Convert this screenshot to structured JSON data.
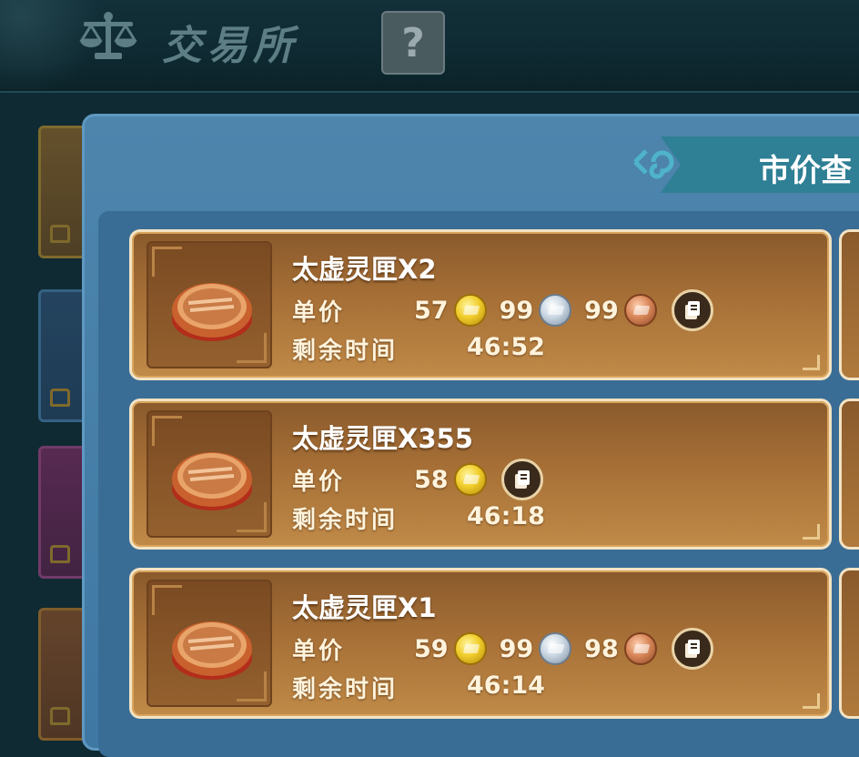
{
  "header": {
    "title": "交易所",
    "help_label": "?"
  },
  "panel": {
    "tab_label": "市价查"
  },
  "listings": [
    {
      "name": "太虚灵匣X2",
      "price_label": "单价",
      "gold": "57",
      "silver": "99",
      "copper": "99",
      "time_label": "剩余时间",
      "time_left": "46:52"
    },
    {
      "name": "太虚灵匣X355",
      "price_label": "单价",
      "gold": "58",
      "time_label": "剩余时间",
      "time_left": "46:18"
    },
    {
      "name": "太虚灵匣X1",
      "price_label": "单价",
      "gold": "59",
      "silver": "99",
      "copper": "98",
      "time_label": "剩余时间",
      "time_left": "46:14"
    }
  ],
  "icons": {
    "header": "balance-scale-icon",
    "tab": "spiral-icon",
    "item": "treasure-box-icon",
    "gold": "gold-coin-icon",
    "silver": "silver-coin-icon",
    "copper": "copper-coin-icon",
    "detail": "document-icon"
  },
  "colors": {
    "panel_blue": "#4d85ad",
    "card_brown": "#a66f36",
    "card_border": "#f3e3c4",
    "tab_teal": "#2f7f95"
  }
}
